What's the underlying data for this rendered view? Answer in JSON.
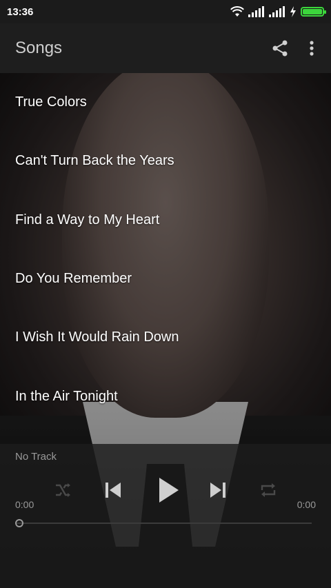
{
  "status_bar": {
    "time": "13:36"
  },
  "toolbar": {
    "title": "Songs",
    "share_icon": "share-icon",
    "more_icon": "more-vert-icon"
  },
  "songs": [
    "True Colors",
    "Can't Turn Back the Years",
    "Find a Way to My Heart",
    "Do You Remember",
    "I Wish It Would Rain Down",
    "In the Air Tonight"
  ],
  "player": {
    "now_playing": "No Track",
    "elapsed": "0:00",
    "duration": "0:00",
    "progress": 0,
    "icons": [
      "shuffle-icon",
      "previous-icon",
      "play-icon",
      "next-icon",
      "repeat-icon"
    ]
  },
  "colors": {
    "battery": "#3cd63c",
    "toolbar_bg": "#1e1e1e",
    "player_bg": "#1c1c1c"
  }
}
